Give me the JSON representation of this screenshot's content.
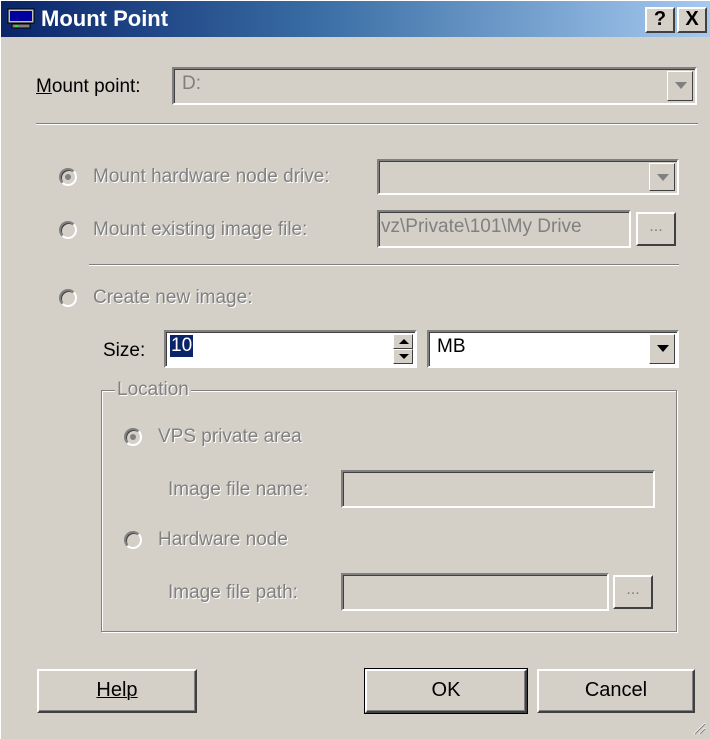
{
  "window": {
    "title": "Mount Point",
    "help_glyph": "?",
    "close_glyph": "X"
  },
  "mount_point": {
    "label": "Mount point:",
    "value": "D:"
  },
  "options": {
    "hardware_drive": {
      "label": "Mount hardware node drive:",
      "value": ""
    },
    "existing_image": {
      "label": "Mount existing image file:",
      "value": "vz\\Private\\101\\My Drive",
      "browse": "..."
    },
    "create_new": {
      "label": "Create new image:"
    }
  },
  "size": {
    "label": "Size:",
    "value": "10",
    "unit": "MB"
  },
  "location": {
    "legend": "Location",
    "vps_private": {
      "label": "VPS private area"
    },
    "image_file_name": {
      "label": "Image file name:",
      "value": ""
    },
    "hardware_node": {
      "label": "Hardware node"
    },
    "image_file_path": {
      "label": "Image file path:",
      "value": "",
      "browse": "..."
    }
  },
  "buttons": {
    "help": "Help",
    "ok": "OK",
    "cancel": "Cancel"
  },
  "colors": {
    "title_gradient_start": "#0a246a",
    "title_gradient_end": "#a6caf0",
    "face": "#d4d0c8",
    "disabled_text": "#808080",
    "selection": "#0a246a"
  }
}
